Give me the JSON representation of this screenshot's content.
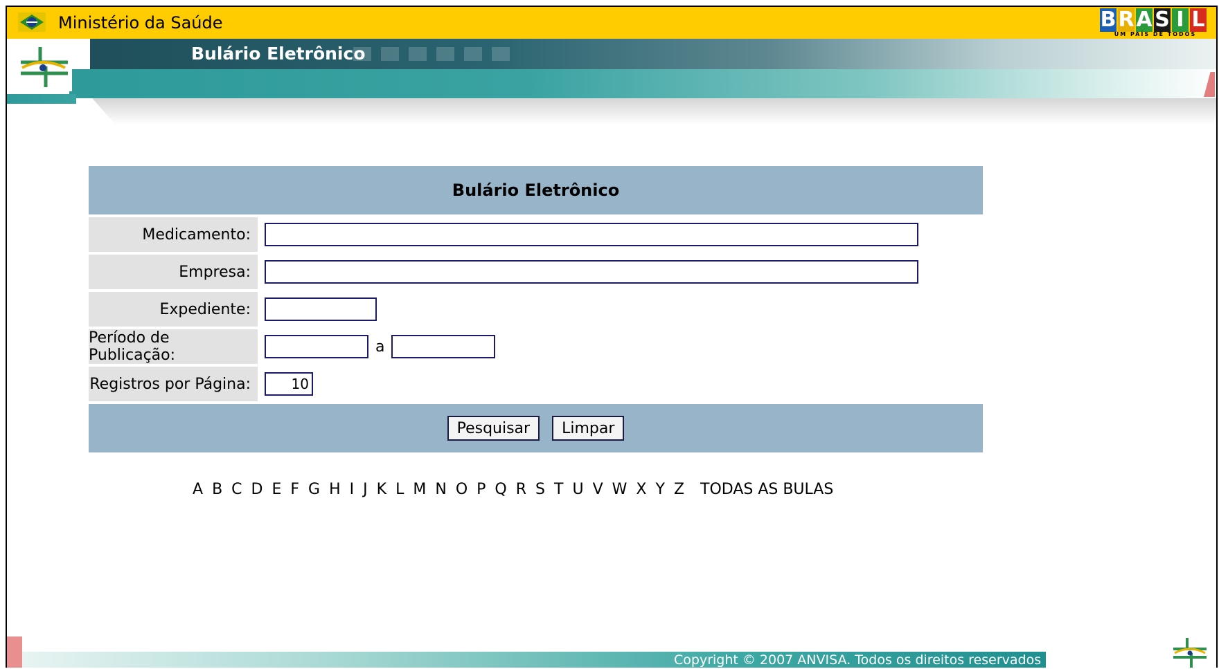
{
  "gov_bar": {
    "title": "Ministério da Saúde",
    "brasil_logo": {
      "letters": [
        "B",
        "R",
        "A",
        "S",
        "I",
        "L"
      ],
      "tagline": "UM PAÍS DE TODOS"
    }
  },
  "header": {
    "title": "Bulário Eletrônico"
  },
  "form": {
    "title": "Bulário Eletrônico",
    "fields": {
      "medicamento": {
        "label": "Medicamento:",
        "value": ""
      },
      "empresa": {
        "label": "Empresa:",
        "value": ""
      },
      "expediente": {
        "label": "Expediente:",
        "value": ""
      },
      "periodo": {
        "label": "Período de Publicação:",
        "from_value": "",
        "separator": "a",
        "to_value": ""
      },
      "registros": {
        "label": "Registros por Página:",
        "value": "10"
      }
    },
    "buttons": {
      "search": "Pesquisar",
      "clear": "Limpar"
    }
  },
  "alphabet": {
    "letters": [
      "A",
      "B",
      "C",
      "D",
      "E",
      "F",
      "G",
      "H",
      "I",
      "J",
      "K",
      "L",
      "M",
      "N",
      "O",
      "P",
      "Q",
      "R",
      "S",
      "T",
      "U",
      "V",
      "W",
      "X",
      "Y",
      "Z"
    ],
    "all_label": "TODAS AS BULAS"
  },
  "footer": {
    "copyright": "Copyright © 2007 ANVISA. Todos os direitos reservados"
  },
  "colors": {
    "gov_bar": "#ffcc00",
    "form_header": "#98b4c8",
    "label_bg": "#e2e2e2",
    "teal": "#2e9a9a",
    "input_border": "#1a1a66"
  }
}
